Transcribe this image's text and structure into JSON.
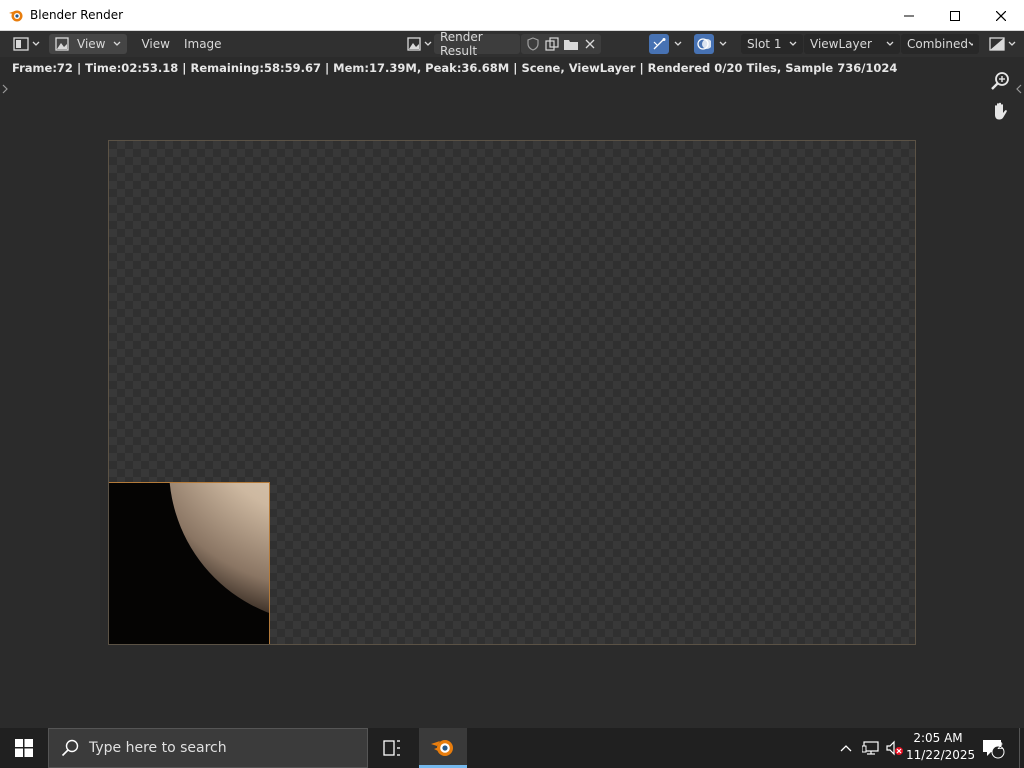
{
  "window": {
    "title": "Blender Render"
  },
  "header": {
    "view_menu_label": "View",
    "view_menu2_label": "View",
    "image_menu_label": "Image",
    "image_name": "Render Result",
    "slot": "Slot 1",
    "view_layer": "ViewLayer",
    "pass": "Combined"
  },
  "stats": {
    "text": "Frame:72 | Time:02:53.18 | Remaining:58:59.67 | Mem:17.39M, Peak:36.68M | Scene, ViewLayer | Rendered 0/20 Tiles, Sample 736/1024"
  },
  "taskbar": {
    "search_placeholder": "Type here to search",
    "time": "2:05 AM",
    "date": "11/22/2025",
    "notification_count": "2"
  },
  "colors": {
    "accent": "#4772b3",
    "tile_border": "#b37a3a",
    "blender_orange": "#e87d0d"
  }
}
